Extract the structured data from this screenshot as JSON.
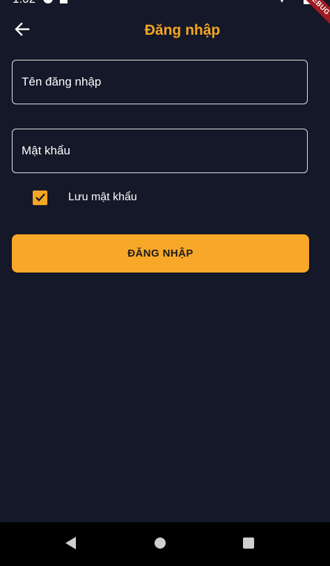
{
  "status_bar": {
    "time": "1:02",
    "icons": [
      "settings-icon",
      "sd-card-icon",
      "wifi-icon",
      "battery-icon"
    ]
  },
  "debug_banner": "DEBUG",
  "app_bar": {
    "title": "Đăng nhập",
    "back_icon": "arrow-left-icon"
  },
  "form": {
    "username_placeholder": "Tên đăng nhập",
    "username_value": "",
    "password_placeholder": "Mật khẩu",
    "password_value": "",
    "remember_label": "Lưu mật khẩu",
    "remember_checked": true,
    "submit_label": "ĐĂNG NHẬP"
  },
  "nav_bar": {
    "icons": [
      "back-triangle-icon",
      "home-circle-icon",
      "recents-square-icon"
    ]
  },
  "colors": {
    "background": "#151828",
    "accent": "#f5a623",
    "button": "#f7a828",
    "ribbon": "#a01c22",
    "nav_bar": "#000000"
  }
}
